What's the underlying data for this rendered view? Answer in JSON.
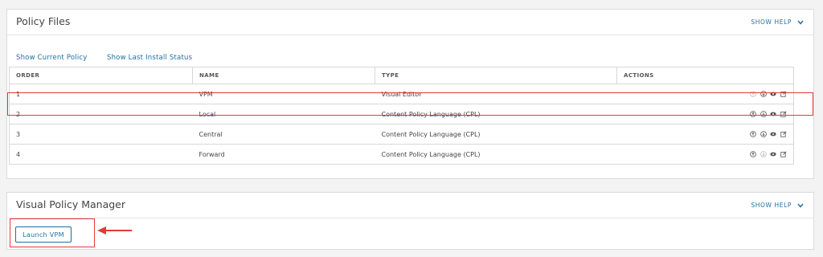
{
  "policy_files": {
    "title": "Policy Files",
    "show_help": "SHOW HELP",
    "links": {
      "show_current_policy": "Show Current Policy",
      "show_last_install_status": "Show Last Install Status"
    },
    "table": {
      "headers": {
        "order": "ORDER",
        "name": "NAME",
        "type": "TYPE",
        "actions": "ACTIONS"
      },
      "rows": [
        {
          "order": "1",
          "name": "VPM",
          "type": "Visual Editor"
        },
        {
          "order": "2",
          "name": "Local",
          "type": "Content Policy Language (CPL)"
        },
        {
          "order": "3",
          "name": "Central",
          "type": "Content Policy Language (CPL)"
        },
        {
          "order": "4",
          "name": "Forward",
          "type": "Content Policy Language (CPL)"
        }
      ]
    }
  },
  "visual_policy_manager": {
    "title": "Visual Policy Manager",
    "show_help": "SHOW HELP",
    "launch_label": "Launch VPM"
  },
  "colors": {
    "accent": "#1d6fa5",
    "highlight": "#e23a3a"
  },
  "icons": {
    "chevron": "chevron-down-icon",
    "upload": "upload-icon",
    "download": "download-icon",
    "view": "eye-icon",
    "edit": "edit-icon",
    "arrow": "arrow-left-icon"
  }
}
